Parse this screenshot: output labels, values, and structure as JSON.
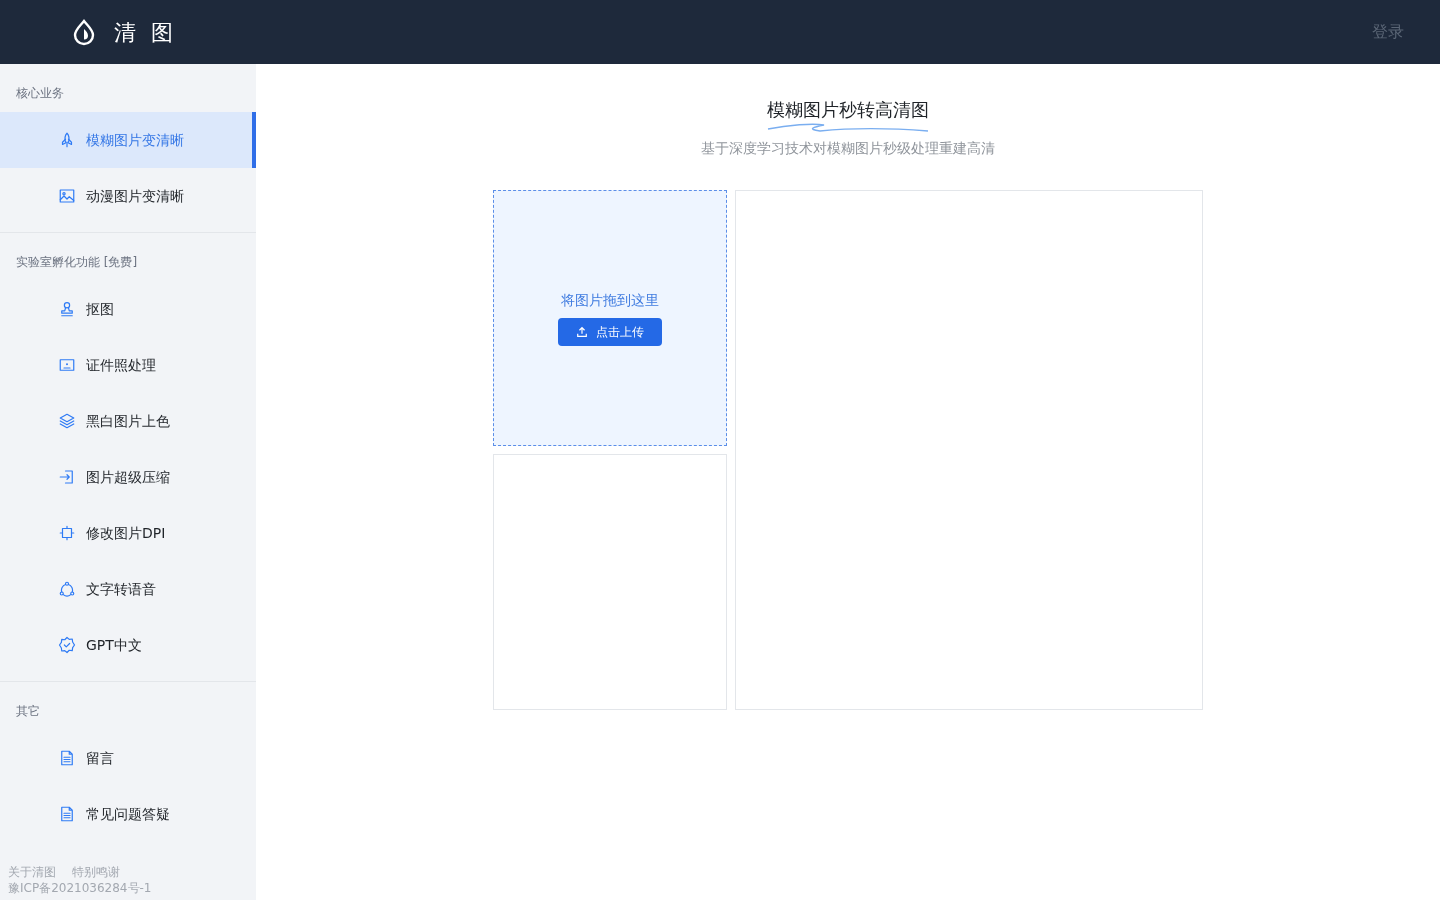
{
  "header": {
    "logo_text": "清 图",
    "login": "登录"
  },
  "sidebar": {
    "sections": [
      {
        "title": "核心业务",
        "items": [
          {
            "label": "模糊图片变清晰",
            "selected": true
          },
          {
            "label": "动漫图片变清晰",
            "selected": false
          }
        ]
      },
      {
        "title": "实验室孵化功能 [免费]",
        "items": [
          {
            "label": "抠图",
            "selected": false
          },
          {
            "label": "证件照处理",
            "selected": false
          },
          {
            "label": "黑白图片上色",
            "selected": false
          },
          {
            "label": "图片超级压缩",
            "selected": false
          },
          {
            "label": "修改图片DPI",
            "selected": false
          },
          {
            "label": "文字转语音",
            "selected": false
          },
          {
            "label": "GPT中文",
            "selected": false
          }
        ]
      },
      {
        "title": "其它",
        "items": [
          {
            "label": "留言",
            "selected": false
          },
          {
            "label": "常见问题答疑",
            "selected": false
          }
        ]
      }
    ],
    "footer_links": [
      "关于清图",
      "特别鸣谢"
    ],
    "icp": "豫ICP备2021036284号-1"
  },
  "main": {
    "title": "模糊图片秒转高清图",
    "subtitle": "基于深度学习技术对模糊图片秒级处理重建高清",
    "upload": {
      "hint": "将图片拖到这里",
      "button": "点击上传"
    }
  }
}
